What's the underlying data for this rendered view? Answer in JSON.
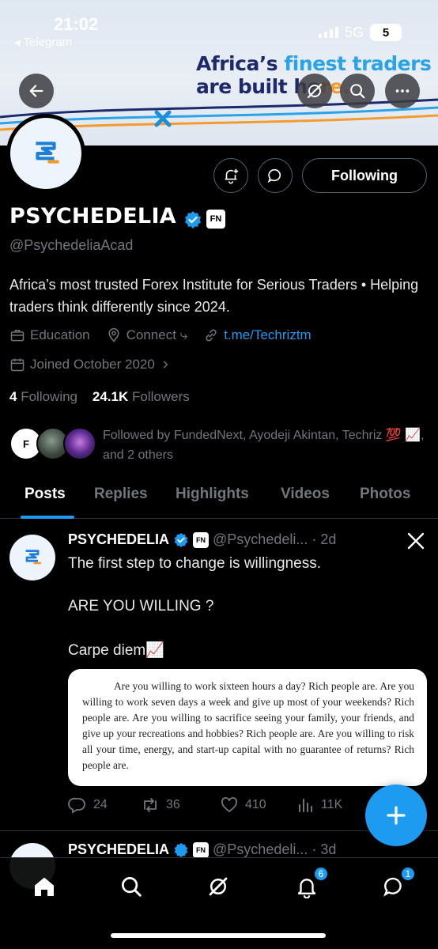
{
  "status_bar": {
    "time": "21:02",
    "back_app": "◂ Telegram",
    "network": "5G",
    "battery": "5"
  },
  "banner": {
    "line1_a": "Africa’s ",
    "line1_b": "finest traders",
    "line2_a": "are built he",
    "line2_b": "re."
  },
  "profile": {
    "name": "PSYCHEDELIA",
    "badge": "FN",
    "handle": "@PsychedeliaAcad",
    "bio": "Africa’s most trusted Forex Institute for Serious Traders • Helping traders think differently since 2024.",
    "category": "Education",
    "location": "Connect ⤷",
    "link": "t.me/Techriztm",
    "joined": "Joined October 2020",
    "following_count": "4",
    "following_label": "Following",
    "followers_count": "24.1K",
    "followers_label": "Followers",
    "followed_by": "Followed by FundedNext, Ayodeji Akintan, Techriz 💯 📈, and 2 others",
    "follow_button": "Following"
  },
  "tabs": [
    "Posts",
    "Replies",
    "Highlights",
    "Videos",
    "Photos"
  ],
  "posts": [
    {
      "name": "PSYCHEDELIA",
      "handle": "@Psychedeli...",
      "time": "· 2d",
      "line1": "The first step to change is willingness.",
      "line2": "ARE YOU WILLING ?",
      "line3": "Carpe diem📈",
      "quote": "Are you willing to work sixteen hours a day? Rich people are. Are you willing to work seven days a week and give up most of your weekends? Rich people are. Are you willing to sacrifice seeing your family, your friends, and give up your recreations and hobbies? Rich people are. Are you willing to risk all your time, energy, and start-up capital with no guarantee of returns? Rich people are.",
      "replies": "24",
      "reposts": "36",
      "likes": "410",
      "views": "11K"
    },
    {
      "name": "PSYCHEDELIA",
      "handle": "@Psychedeli...",
      "time": "· 3d"
    }
  ],
  "nav": {
    "notifications_badge": "6",
    "messages_badge": "1"
  },
  "colors": {
    "accent": "#1d9bf0",
    "background": "#000000",
    "muted": "#71767b"
  }
}
